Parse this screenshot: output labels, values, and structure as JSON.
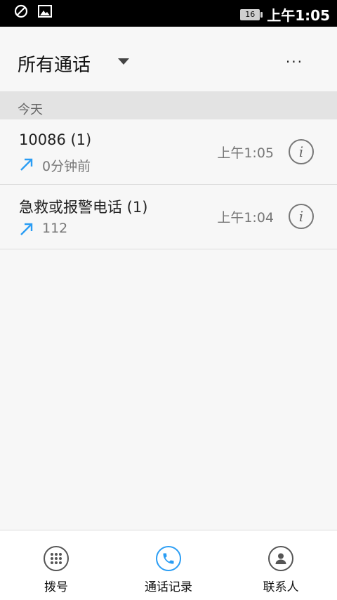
{
  "status_bar": {
    "time": "上午1:05",
    "battery": "16",
    "icons": [
      "dnd-icon",
      "image-icon"
    ]
  },
  "header": {
    "title": "所有通话",
    "more_label": "···"
  },
  "section": {
    "label": "今天"
  },
  "calls": [
    {
      "name": "10086 (1)",
      "detail": "0分钟前",
      "time": "上午1:05",
      "direction": "outgoing",
      "info_label": "i"
    },
    {
      "name": "急救或报警电话 (1)",
      "detail": "112",
      "time": "上午1:04",
      "direction": "outgoing",
      "info_label": "i"
    }
  ],
  "bottom_nav": {
    "items": [
      {
        "label": "拨号",
        "icon": "dialpad-icon",
        "active": false
      },
      {
        "label": "通话记录",
        "icon": "phone-icon",
        "active": true
      },
      {
        "label": "联系人",
        "icon": "contact-icon",
        "active": false
      }
    ]
  },
  "colors": {
    "accent": "#2a9df4",
    "status_bar": "#000000",
    "section_bg": "#e3e3e3"
  }
}
